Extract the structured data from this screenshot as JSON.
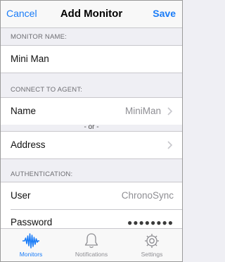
{
  "navbar": {
    "cancel_label": "Cancel",
    "title": "Add Monitor",
    "save_label": "Save"
  },
  "monitor_name": {
    "header": "MONITOR NAME:",
    "value": "Mini Man"
  },
  "agent": {
    "header": "CONNECT TO AGENT:",
    "name_label": "Name",
    "name_value": "MiniMan",
    "or_text": "- or -",
    "address_label": "Address"
  },
  "auth": {
    "header": "AUTHENTICATION:",
    "user_label": "User",
    "user_value": "ChronoSync",
    "password_label": "Password",
    "password_value": "●●●●●●●●"
  },
  "tabs": [
    {
      "label": "Monitors",
      "icon": "waveform-icon"
    },
    {
      "label": "Notifications",
      "icon": "bell-icon"
    },
    {
      "label": "Settings",
      "icon": "gear-icon"
    }
  ],
  "colors": {
    "accent": "#1a7cf7",
    "background": "#efeff4",
    "separator": "#c8c7cc"
  }
}
